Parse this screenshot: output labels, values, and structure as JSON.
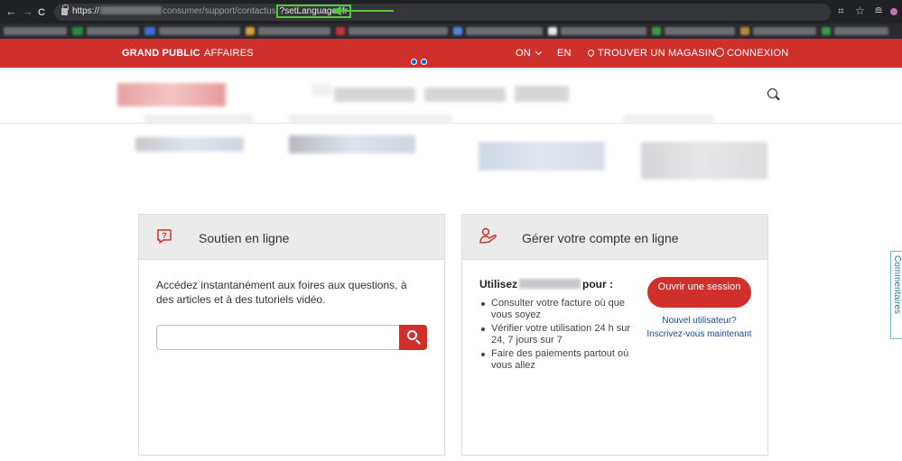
{
  "browser": {
    "back": "←",
    "forward": "→",
    "reload": "C",
    "url_prefix": "https://",
    "url_path": "consumer/support/contactus",
    "url_param": "?setLanguage=fr",
    "right_icons": [
      "translate-icon",
      "star-icon",
      "extension-icon",
      "menu-icon"
    ]
  },
  "topbar": {
    "grand_public": "GRAND PUBLIC",
    "affaires": "AFFAIRES",
    "province": "ON",
    "lang": "EN",
    "store": "TROUVER UN MAGASIN",
    "login": "CONNEXION"
  },
  "card1": {
    "title": "Soutien en ligne",
    "description": "Accédez instantanément aux foires aux questions, à des articles et à des tutoriels vidéo.",
    "search_value": ""
  },
  "card2": {
    "title": "Gérer votre compte en ligne",
    "use_prefix": "Utilisez",
    "use_suffix": "pour :",
    "bullets": [
      "Consulter votre facture où que vous soyez",
      "Vérifier votre utilisation 24 h sur 24, 7 jours sur 7",
      "Faire des paiements partout où vous allez"
    ],
    "login_button": "Ouvrir une session",
    "new_user": "Nouvel utilisateur?",
    "register": "Inscrivez-vous maintenant"
  },
  "side_tab": {
    "label": "Commentaires"
  },
  "colors": {
    "brand_red": "#d0302c",
    "link_blue": "#1a4b8f",
    "annotation_green": "#55c93e"
  }
}
